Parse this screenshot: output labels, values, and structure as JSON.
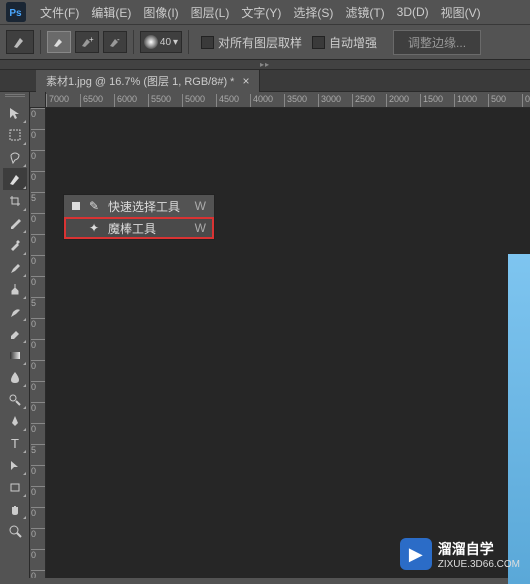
{
  "menubar": {
    "items": [
      "文件(F)",
      "编辑(E)",
      "图像(I)",
      "图层(L)",
      "文字(Y)",
      "选择(S)",
      "滤镜(T)",
      "3D(D)",
      "视图(V)"
    ]
  },
  "optionsbar": {
    "brush_size": "40",
    "sample_all": "对所有图层取样",
    "auto_enhance": "自动增强",
    "refine_edge": "调整边缘..."
  },
  "doc_tab": {
    "title": "素材1.jpg @ 16.7% (图层 1, RGB/8#) *"
  },
  "ruler_h": [
    "7000",
    "6500",
    "6000",
    "5500",
    "5000",
    "4500",
    "4000",
    "3500",
    "3000",
    "2500",
    "2000",
    "1500",
    "1000",
    "500",
    "0"
  ],
  "ruler_v": [
    "0",
    "0",
    "0",
    "0",
    "5",
    "0",
    "0",
    "0",
    "0",
    "5",
    "0",
    "0",
    "0",
    "0",
    "0",
    "0",
    "5",
    "0",
    "0",
    "0",
    "0",
    "0",
    "0"
  ],
  "flyout": {
    "items": [
      {
        "label": "快速选择工具",
        "key": "W"
      },
      {
        "label": "魔棒工具",
        "key": "W"
      }
    ]
  },
  "watermark": {
    "title": "溜溜自学",
    "sub": "ZIXUE.3D66.COM"
  }
}
